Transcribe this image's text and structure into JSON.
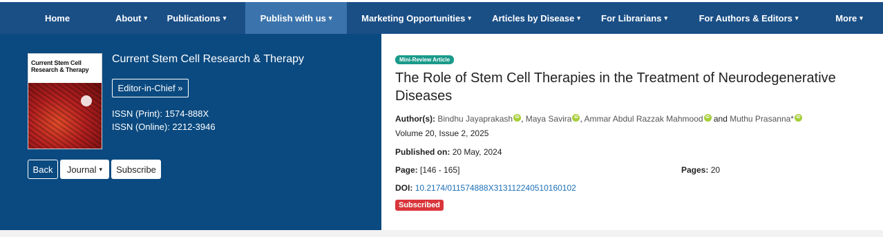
{
  "nav": {
    "items": [
      {
        "label": "Home",
        "caret": ""
      },
      {
        "label": "About",
        "caret": "▾"
      },
      {
        "label": "Publications",
        "caret": "▾"
      },
      {
        "label": "Publish with us",
        "caret": "▾"
      },
      {
        "label": "Marketing Opportunities",
        "caret": "▾"
      },
      {
        "label": "Articles by Disease",
        "caret": "▾"
      },
      {
        "label": "For Librarians",
        "caret": "▾"
      },
      {
        "label": "For Authors & Editors",
        "caret": "▾"
      },
      {
        "label": "More",
        "caret": "▾"
      }
    ],
    "active_item": "Publish with us"
  },
  "journal": {
    "cover_title": "Current Stem Cell Research & Therapy",
    "title": "Current Stem Cell Research & Therapy",
    "editor_button": "Editor-in-Chief »",
    "issn_print": "ISSN (Print): 1574-888X",
    "issn_online": "ISSN (Online): 2212-3946"
  },
  "actions": {
    "back": "Back",
    "journal": "Journal",
    "journal_caret": "▾",
    "subscribe": "Subscribe"
  },
  "article": {
    "type_badge": "Mini-Review Article",
    "title": "The Role of Stem Cell Therapies in the Treatment of Neurodegenerative Diseases",
    "authors_label": "Author(s):",
    "authors": [
      "Bindhu Jayaprakash",
      "Maya Savira",
      "Ammar Abdul Razzak Mahmood",
      "Muthu Prasanna*"
    ],
    "author_separators": [
      ", ",
      ", ",
      " and "
    ],
    "orcid_label": "iD",
    "volume": "Volume 20, Issue 2, 2025",
    "published_label": "Published on:",
    "published_date": "20 May, 2024",
    "page_label": "Page:",
    "page_range": "[146 - 165]",
    "pages_label": "Pages:",
    "pages_count": "20",
    "doi_label": "DOI:",
    "doi": "10.2174/011574888X313112240510160102",
    "access_badge": "Subscribed"
  },
  "colors": {
    "nav_bg": "#1a4f86",
    "nav_active": "#3b74ad",
    "left_panel": "#0b4a80",
    "badge_mini": "#1a9a8a",
    "subscribed": "#d9353b",
    "orcid": "#a6ce39",
    "link": "#1a6fb5"
  }
}
